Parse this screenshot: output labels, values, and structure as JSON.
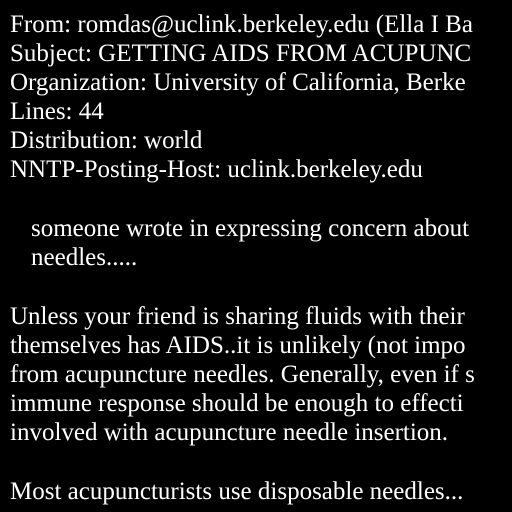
{
  "headers": {
    "from": "From: romdas@uclink.berkeley.edu (Ella I Ba",
    "subject": "Subject: GETTING AIDS FROM ACUPUNC",
    "organization": "Organization: University of California, Berke",
    "lines": "Lines: 44",
    "distribution": "Distribution: world",
    "nntp_posting_host": "NNTP-Posting-Host: uclink.berkeley.edu"
  },
  "quote": [
    "someone wrote in expressing concern about",
    "needles....."
  ],
  "body": {
    "paragraph1": [
      "Unless your friend is sharing fluids with their",
      "themselves has AIDS..it is unlikely (not impo",
      "from acupuncture needles. Generally, even if s",
      "immune response should be enough to effecti",
      "involved with acupuncture needle insertion."
    ],
    "paragraph2": [
      "Most acupuncturists use disposable needles..."
    ]
  },
  "colors": {
    "background": "#000000",
    "text": "#ffffff"
  }
}
